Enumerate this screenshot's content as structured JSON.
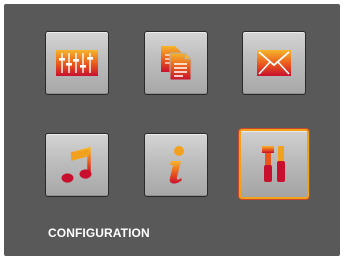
{
  "screen": {
    "caption": "CONFIGURATION",
    "selected_index": 5
  },
  "tiles": [
    {
      "icon": "equalizer-icon",
      "selected": false
    },
    {
      "icon": "documents-icon",
      "selected": false
    },
    {
      "icon": "envelope-icon",
      "selected": false
    },
    {
      "icon": "music-note-icon",
      "selected": false
    },
    {
      "icon": "info-icon",
      "selected": false
    },
    {
      "icon": "tools-icon",
      "selected": true
    }
  ],
  "colors": {
    "screen_bg": "#595959",
    "icon_gradient_top": "#f5a623",
    "icon_gradient_bottom": "#c8102e",
    "selection_border": "#f0a21d",
    "caption_text": "#ffffff"
  }
}
